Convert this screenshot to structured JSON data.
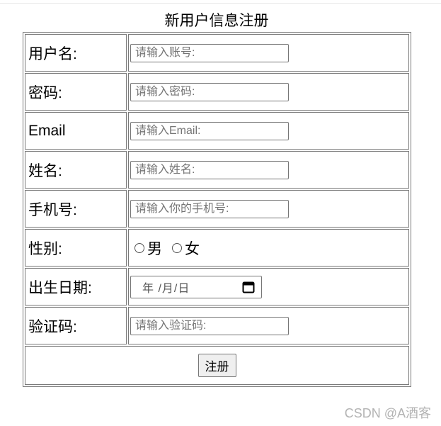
{
  "form": {
    "title": "新用户信息注册",
    "fields": {
      "account": {
        "label": "用户名:",
        "placeholder": "请输入账号:"
      },
      "password": {
        "label": "密码:",
        "placeholder": "请输入密码:"
      },
      "email": {
        "label": "Email",
        "placeholder": "请输入Email:"
      },
      "name": {
        "label": "姓名:",
        "placeholder": "请输入姓名:"
      },
      "phone": {
        "label": "手机号:",
        "placeholder": "请输入你的手机号:"
      },
      "gender": {
        "label": "性别:",
        "options": [
          "男",
          "女"
        ]
      },
      "birthday": {
        "label": "出生日期:",
        "display": "年 /月/日"
      },
      "captcha": {
        "label": "验证码:",
        "placeholder": "请输入验证码:"
      }
    },
    "submit_label": "注册"
  },
  "watermark": "CSDN @A酒客"
}
